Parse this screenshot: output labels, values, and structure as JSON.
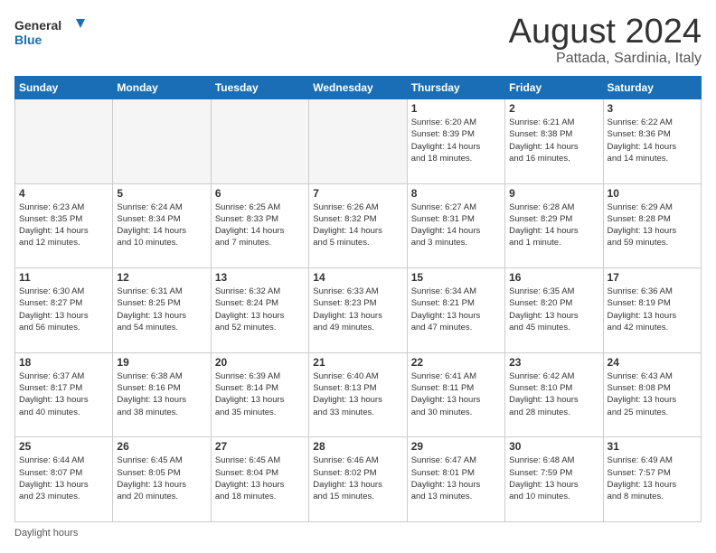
{
  "logo": {
    "line1": "General",
    "line2": "Blue"
  },
  "title": "August 2024",
  "location": "Pattada, Sardinia, Italy",
  "days_of_week": [
    "Sunday",
    "Monday",
    "Tuesday",
    "Wednesday",
    "Thursday",
    "Friday",
    "Saturday"
  ],
  "footer": "Daylight hours",
  "weeks": [
    [
      {
        "day": "",
        "info": ""
      },
      {
        "day": "",
        "info": ""
      },
      {
        "day": "",
        "info": ""
      },
      {
        "day": "",
        "info": ""
      },
      {
        "day": "1",
        "info": "Sunrise: 6:20 AM\nSunset: 8:39 PM\nDaylight: 14 hours\nand 18 minutes."
      },
      {
        "day": "2",
        "info": "Sunrise: 6:21 AM\nSunset: 8:38 PM\nDaylight: 14 hours\nand 16 minutes."
      },
      {
        "day": "3",
        "info": "Sunrise: 6:22 AM\nSunset: 8:36 PM\nDaylight: 14 hours\nand 14 minutes."
      }
    ],
    [
      {
        "day": "4",
        "info": "Sunrise: 6:23 AM\nSunset: 8:35 PM\nDaylight: 14 hours\nand 12 minutes."
      },
      {
        "day": "5",
        "info": "Sunrise: 6:24 AM\nSunset: 8:34 PM\nDaylight: 14 hours\nand 10 minutes."
      },
      {
        "day": "6",
        "info": "Sunrise: 6:25 AM\nSunset: 8:33 PM\nDaylight: 14 hours\nand 7 minutes."
      },
      {
        "day": "7",
        "info": "Sunrise: 6:26 AM\nSunset: 8:32 PM\nDaylight: 14 hours\nand 5 minutes."
      },
      {
        "day": "8",
        "info": "Sunrise: 6:27 AM\nSunset: 8:31 PM\nDaylight: 14 hours\nand 3 minutes."
      },
      {
        "day": "9",
        "info": "Sunrise: 6:28 AM\nSunset: 8:29 PM\nDaylight: 14 hours\nand 1 minute."
      },
      {
        "day": "10",
        "info": "Sunrise: 6:29 AM\nSunset: 8:28 PM\nDaylight: 13 hours\nand 59 minutes."
      }
    ],
    [
      {
        "day": "11",
        "info": "Sunrise: 6:30 AM\nSunset: 8:27 PM\nDaylight: 13 hours\nand 56 minutes."
      },
      {
        "day": "12",
        "info": "Sunrise: 6:31 AM\nSunset: 8:25 PM\nDaylight: 13 hours\nand 54 minutes."
      },
      {
        "day": "13",
        "info": "Sunrise: 6:32 AM\nSunset: 8:24 PM\nDaylight: 13 hours\nand 52 minutes."
      },
      {
        "day": "14",
        "info": "Sunrise: 6:33 AM\nSunset: 8:23 PM\nDaylight: 13 hours\nand 49 minutes."
      },
      {
        "day": "15",
        "info": "Sunrise: 6:34 AM\nSunset: 8:21 PM\nDaylight: 13 hours\nand 47 minutes."
      },
      {
        "day": "16",
        "info": "Sunrise: 6:35 AM\nSunset: 8:20 PM\nDaylight: 13 hours\nand 45 minutes."
      },
      {
        "day": "17",
        "info": "Sunrise: 6:36 AM\nSunset: 8:19 PM\nDaylight: 13 hours\nand 42 minutes."
      }
    ],
    [
      {
        "day": "18",
        "info": "Sunrise: 6:37 AM\nSunset: 8:17 PM\nDaylight: 13 hours\nand 40 minutes."
      },
      {
        "day": "19",
        "info": "Sunrise: 6:38 AM\nSunset: 8:16 PM\nDaylight: 13 hours\nand 38 minutes."
      },
      {
        "day": "20",
        "info": "Sunrise: 6:39 AM\nSunset: 8:14 PM\nDaylight: 13 hours\nand 35 minutes."
      },
      {
        "day": "21",
        "info": "Sunrise: 6:40 AM\nSunset: 8:13 PM\nDaylight: 13 hours\nand 33 minutes."
      },
      {
        "day": "22",
        "info": "Sunrise: 6:41 AM\nSunset: 8:11 PM\nDaylight: 13 hours\nand 30 minutes."
      },
      {
        "day": "23",
        "info": "Sunrise: 6:42 AM\nSunset: 8:10 PM\nDaylight: 13 hours\nand 28 minutes."
      },
      {
        "day": "24",
        "info": "Sunrise: 6:43 AM\nSunset: 8:08 PM\nDaylight: 13 hours\nand 25 minutes."
      }
    ],
    [
      {
        "day": "25",
        "info": "Sunrise: 6:44 AM\nSunset: 8:07 PM\nDaylight: 13 hours\nand 23 minutes."
      },
      {
        "day": "26",
        "info": "Sunrise: 6:45 AM\nSunset: 8:05 PM\nDaylight: 13 hours\nand 20 minutes."
      },
      {
        "day": "27",
        "info": "Sunrise: 6:45 AM\nSunset: 8:04 PM\nDaylight: 13 hours\nand 18 minutes."
      },
      {
        "day": "28",
        "info": "Sunrise: 6:46 AM\nSunset: 8:02 PM\nDaylight: 13 hours\nand 15 minutes."
      },
      {
        "day": "29",
        "info": "Sunrise: 6:47 AM\nSunset: 8:01 PM\nDaylight: 13 hours\nand 13 minutes."
      },
      {
        "day": "30",
        "info": "Sunrise: 6:48 AM\nSunset: 7:59 PM\nDaylight: 13 hours\nand 10 minutes."
      },
      {
        "day": "31",
        "info": "Sunrise: 6:49 AM\nSunset: 7:57 PM\nDaylight: 13 hours\nand 8 minutes."
      }
    ]
  ]
}
